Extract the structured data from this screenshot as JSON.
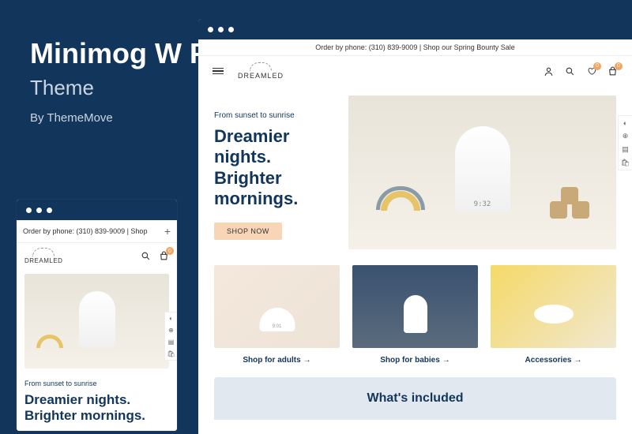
{
  "theme": {
    "title": "Minimog W P",
    "subtitle": "Theme",
    "author": "By ThemeMove"
  },
  "announce": {
    "desktop": "Order by phone: (310) 839-9009 | Shop our Spring Bounty Sale",
    "mobile": "Order by phone: (310) 839-9009 | Shop"
  },
  "brand": "DREAMLED",
  "badges": {
    "wishlist": "0",
    "cart": "0"
  },
  "hero": {
    "eyebrow": "From sunset to sunrise",
    "title": "Dreamier nights. Brighter mornings.",
    "cta": "SHOP NOW"
  },
  "categories": [
    {
      "label": "Shop for adults"
    },
    {
      "label": "Shop for babies"
    },
    {
      "label": "Accessories"
    }
  ],
  "included": {
    "title": "What's included"
  },
  "arrow": "→",
  "plus": "+"
}
